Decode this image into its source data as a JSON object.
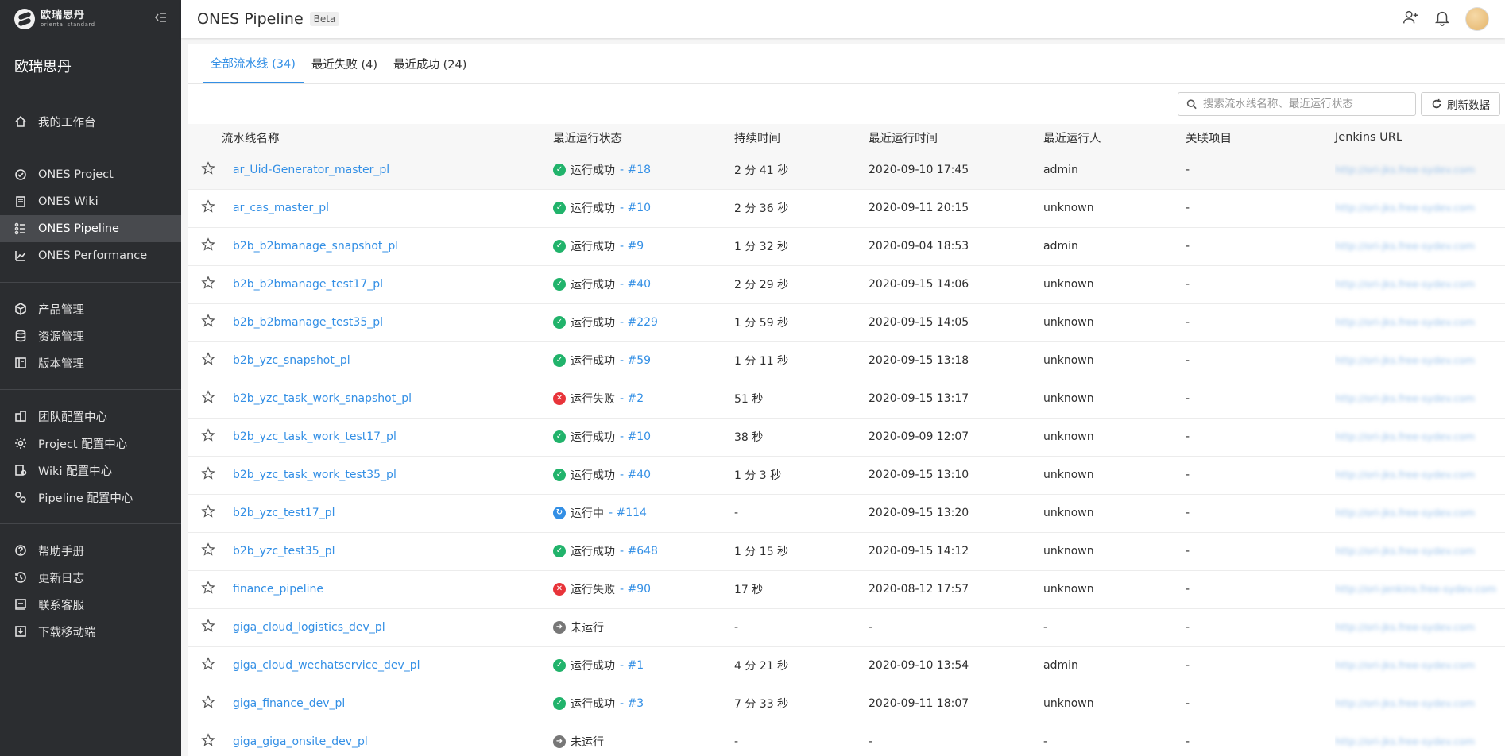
{
  "brand": {
    "logo_cn": "欧瑞思丹",
    "logo_en": "oriental standard",
    "org_name": "欧瑞思丹"
  },
  "header": {
    "title": "ONES Pipeline",
    "badge": "Beta"
  },
  "sidebar": {
    "groups": [
      [
        {
          "label": "我的工作台",
          "icon": "home-icon"
        }
      ],
      [
        {
          "label": "ONES Project",
          "icon": "check-circle-icon"
        },
        {
          "label": "ONES Wiki",
          "icon": "book-icon"
        },
        {
          "label": "ONES Pipeline",
          "icon": "pipeline-icon",
          "active": true
        },
        {
          "label": "ONES Performance",
          "icon": "chart-icon"
        }
      ],
      [
        {
          "label": "产品管理",
          "icon": "cube-icon"
        },
        {
          "label": "资源管理",
          "icon": "database-icon"
        },
        {
          "label": "版本管理",
          "icon": "version-icon"
        }
      ],
      [
        {
          "label": "团队配置中心",
          "icon": "team-config-icon"
        },
        {
          "label": "Project 配置中心",
          "icon": "gear-icon"
        },
        {
          "label": "Wiki 配置中心",
          "icon": "wiki-config-icon"
        },
        {
          "label": "Pipeline 配置中心",
          "icon": "pipeline-config-icon"
        }
      ],
      [
        {
          "label": "帮助手册",
          "icon": "help-icon"
        },
        {
          "label": "更新日志",
          "icon": "history-icon"
        },
        {
          "label": "联系客服",
          "icon": "message-icon"
        },
        {
          "label": "下载移动端",
          "icon": "download-icon"
        }
      ]
    ]
  },
  "tabs": [
    {
      "label": "全部流水线 (34)",
      "active": true
    },
    {
      "label": "最近失败 (4)"
    },
    {
      "label": "最近成功 (24)"
    }
  ],
  "toolbar": {
    "search_placeholder": "搜索流水线名称、最近运行状态",
    "refresh_label": "刷新数据"
  },
  "table": {
    "headers": [
      "流水线名称",
      "最近运行状态",
      "持续时间",
      "最近运行时间",
      "最近运行人",
      "关联项目",
      "Jenkins URL"
    ],
    "rows": [
      {
        "name": "ar_Uid-Generator_master_pl",
        "status": "success",
        "status_text": "运行成功",
        "run": "- #18",
        "duration": "2 分 41 秒",
        "time": "2020-09-10 17:45",
        "user": "admin",
        "project": "-",
        "jenkins": "http://ori-jks.free-sydev.com"
      },
      {
        "name": "ar_cas_master_pl",
        "status": "success",
        "status_text": "运行成功",
        "run": "- #10",
        "duration": "2 分 36 秒",
        "time": "2020-09-11 20:15",
        "user": "unknown",
        "project": "-",
        "jenkins": "http://ori-jks.free-sydev.com"
      },
      {
        "name": "b2b_b2bmanage_snapshot_pl",
        "status": "success",
        "status_text": "运行成功",
        "run": "- #9",
        "duration": "1 分 32 秒",
        "time": "2020-09-04 18:53",
        "user": "admin",
        "project": "-",
        "jenkins": "http://ori-jks.free-sydev.com"
      },
      {
        "name": "b2b_b2bmanage_test17_pl",
        "status": "success",
        "status_text": "运行成功",
        "run": "- #40",
        "duration": "2 分 29 秒",
        "time": "2020-09-15 14:06",
        "user": "unknown",
        "project": "-",
        "jenkins": "http://ori-jks.free-sydev.com"
      },
      {
        "name": "b2b_b2bmanage_test35_pl",
        "status": "success",
        "status_text": "运行成功",
        "run": "- #229",
        "duration": "1 分 59 秒",
        "time": "2020-09-15 14:05",
        "user": "unknown",
        "project": "-",
        "jenkins": "http://ori-jks.free-sydev.com"
      },
      {
        "name": "b2b_yzc_snapshot_pl",
        "status": "success",
        "status_text": "运行成功",
        "run": "- #59",
        "duration": "1 分 11 秒",
        "time": "2020-09-15 13:18",
        "user": "unknown",
        "project": "-",
        "jenkins": "http://ori-jks.free-sydev.com"
      },
      {
        "name": "b2b_yzc_task_work_snapshot_pl",
        "status": "fail",
        "status_text": "运行失败",
        "run": "- #2",
        "duration": "51 秒",
        "time": "2020-09-15 13:17",
        "user": "unknown",
        "project": "-",
        "jenkins": "http://ori-jks.free-sydev.com"
      },
      {
        "name": "b2b_yzc_task_work_test17_pl",
        "status": "success",
        "status_text": "运行成功",
        "run": "- #10",
        "duration": "38 秒",
        "time": "2020-09-09 12:07",
        "user": "unknown",
        "project": "-",
        "jenkins": "http://ori-jks.free-sydev.com"
      },
      {
        "name": "b2b_yzc_task_work_test35_pl",
        "status": "success",
        "status_text": "运行成功",
        "run": "- #40",
        "duration": "1 分 3 秒",
        "time": "2020-09-15 13:10",
        "user": "unknown",
        "project": "-",
        "jenkins": "http://ori-jks.free-sydev.com"
      },
      {
        "name": "b2b_yzc_test17_pl",
        "status": "running",
        "status_text": "运行中",
        "run": "- #114",
        "duration": "-",
        "time": "2020-09-15 13:20",
        "user": "unknown",
        "project": "-",
        "jenkins": "http://ori-jks.free-sydev.com"
      },
      {
        "name": "b2b_yzc_test35_pl",
        "status": "success",
        "status_text": "运行成功",
        "run": "- #648",
        "duration": "1 分 15 秒",
        "time": "2020-09-15 14:12",
        "user": "unknown",
        "project": "-",
        "jenkins": "http://ori-jks.free-sydev.com"
      },
      {
        "name": "finance_pipeline",
        "status": "fail",
        "status_text": "运行失败",
        "run": "- #90",
        "duration": "17 秒",
        "time": "2020-08-12 17:57",
        "user": "unknown",
        "project": "-",
        "jenkins": "http://ori-jenkins.free-sydev.com"
      },
      {
        "name": "giga_cloud_logistics_dev_pl",
        "status": "none",
        "status_text": "未运行",
        "run": "",
        "duration": "-",
        "time": "-",
        "user": "-",
        "project": "-",
        "jenkins": "http://ori-jks.free-sydev.com"
      },
      {
        "name": "giga_cloud_wechatservice_dev_pl",
        "status": "success",
        "status_text": "运行成功",
        "run": "- #1",
        "duration": "4 分 21 秒",
        "time": "2020-09-10 13:54",
        "user": "admin",
        "project": "-",
        "jenkins": "http://ori-jks.free-sydev.com"
      },
      {
        "name": "giga_finance_dev_pl",
        "status": "success",
        "status_text": "运行成功",
        "run": "- #3",
        "duration": "7 分 33 秒",
        "time": "2020-09-11 18:07",
        "user": "unknown",
        "project": "-",
        "jenkins": "http://ori-jks.free-sydev.com"
      },
      {
        "name": "giga_giga_onsite_dev_pl",
        "status": "none",
        "status_text": "未运行",
        "run": "",
        "duration": "-",
        "time": "-",
        "user": "-",
        "project": "-",
        "jenkins": "http://ori-jks.free-sydev.com"
      }
    ]
  },
  "colors": {
    "sidebar_bg": "#2b2d30",
    "accent": "#338fe5",
    "success": "#21b36b",
    "fail": "#e8343a"
  }
}
